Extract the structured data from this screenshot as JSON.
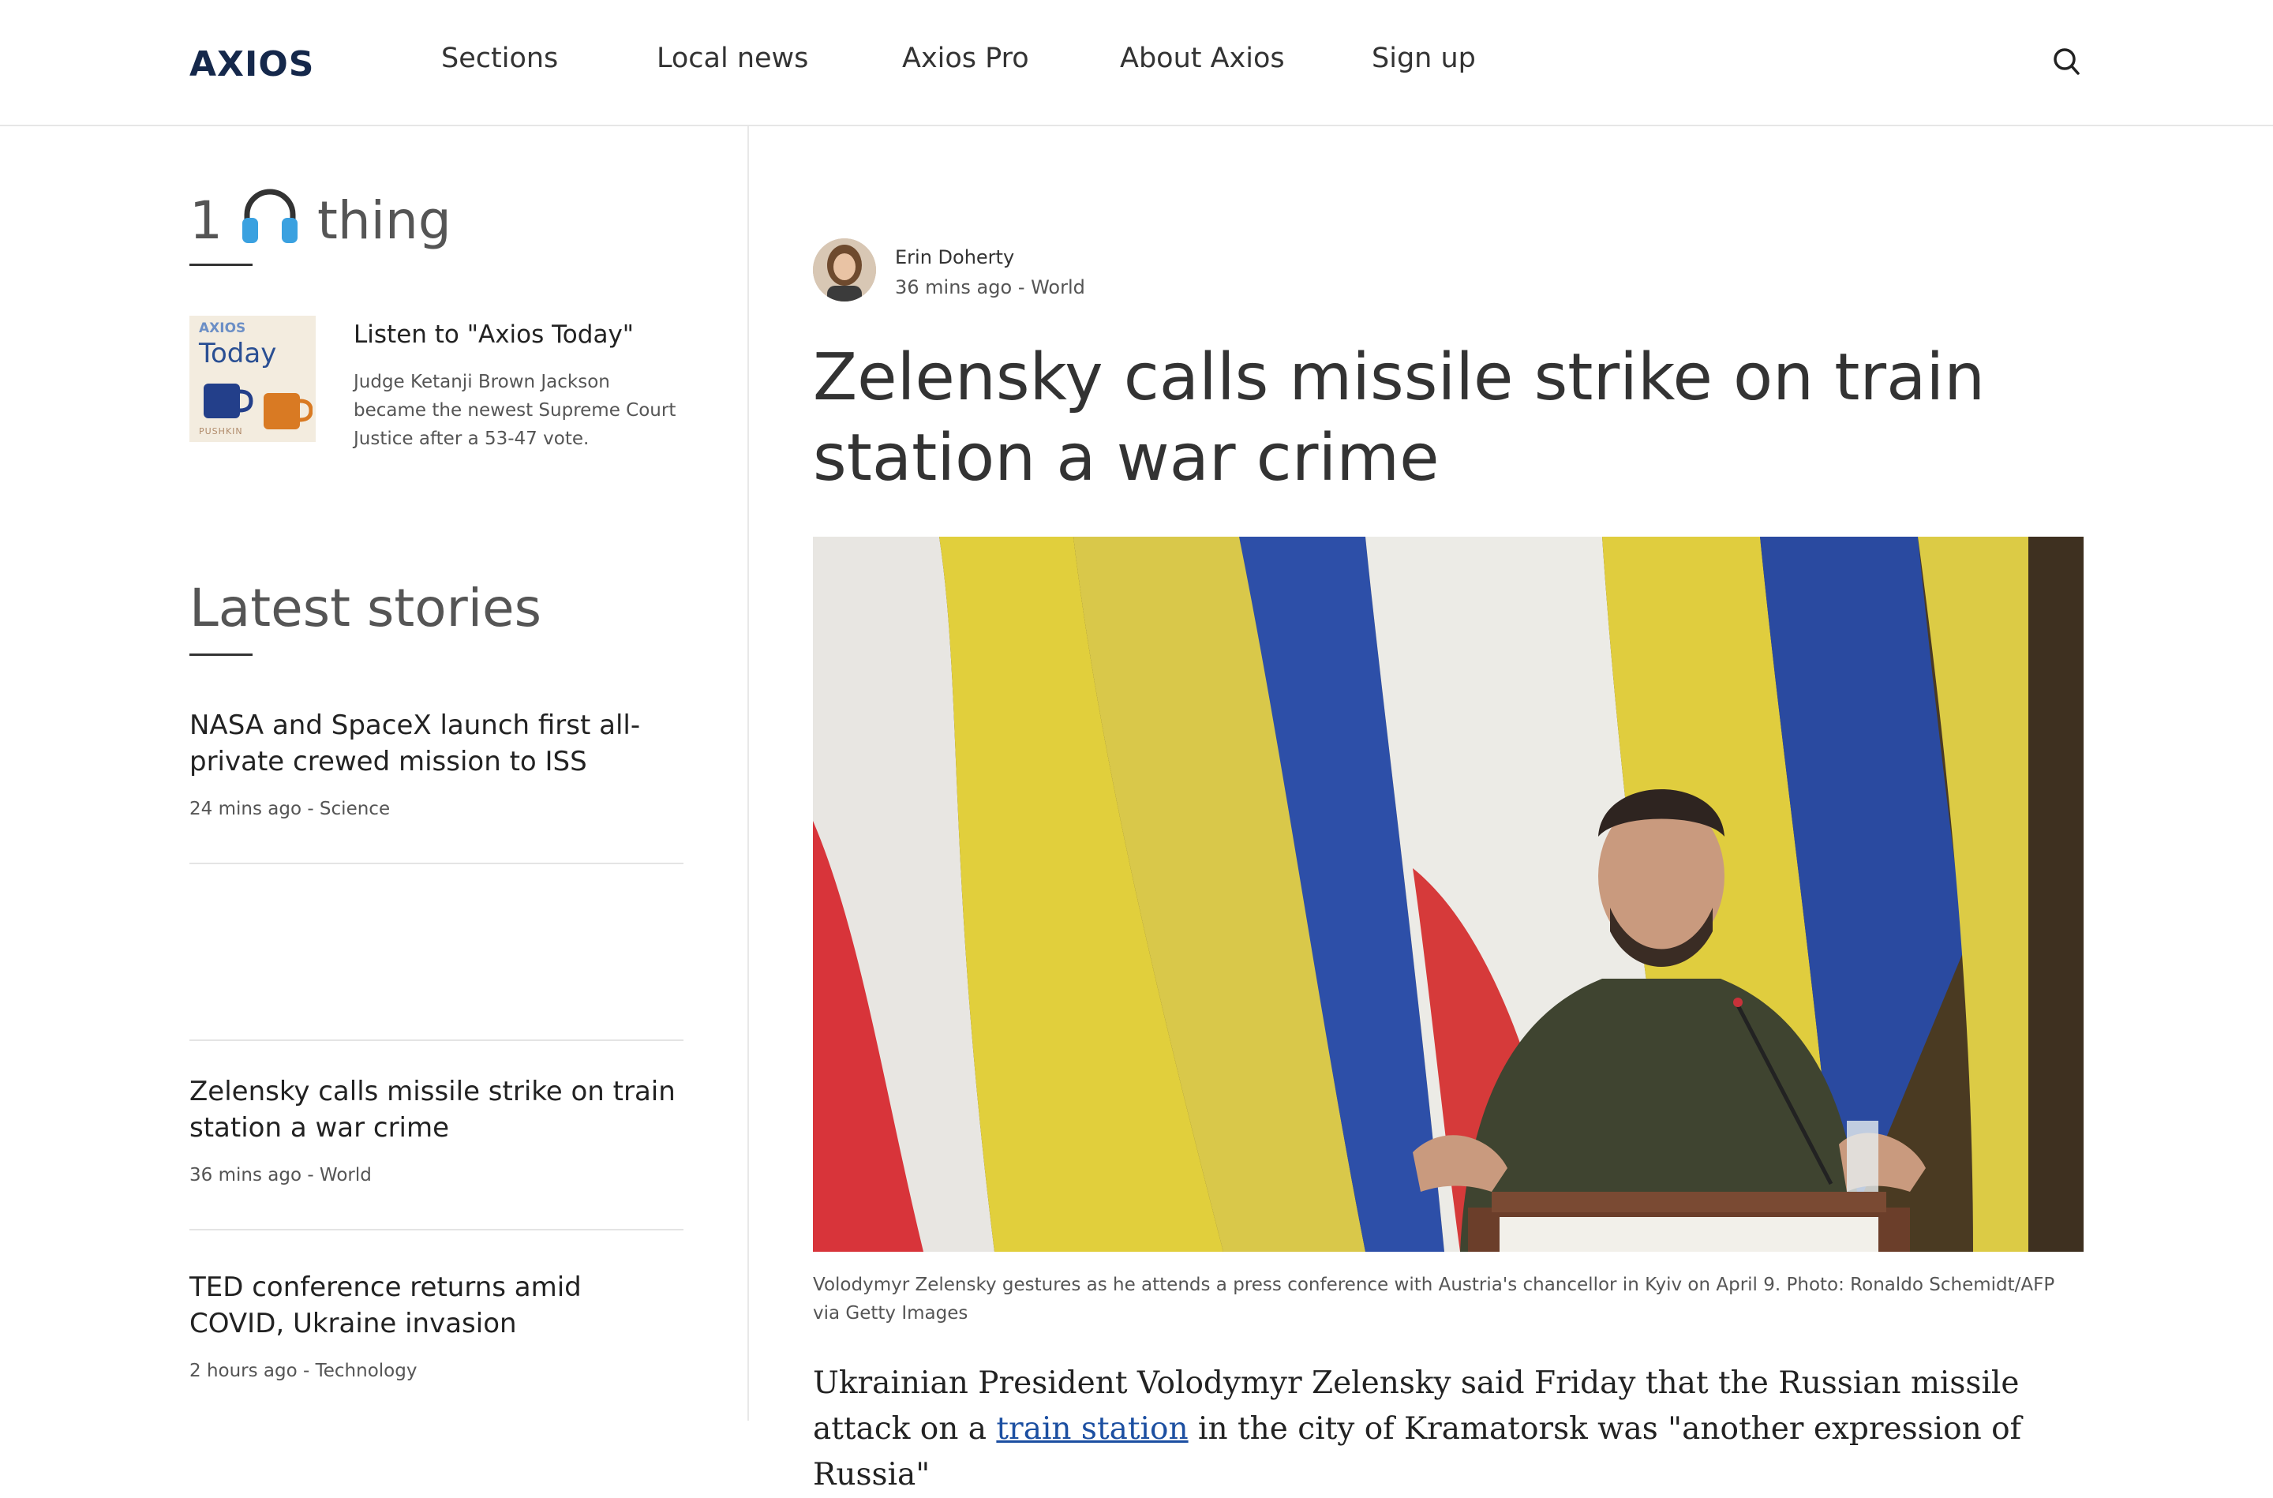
{
  "header": {
    "logo": "AXIOS",
    "nav": [
      "Sections",
      "Local news",
      "Axios Pro",
      "About Axios",
      "Sign up"
    ]
  },
  "sidebar": {
    "one_thing": {
      "number": "1",
      "word": "thing"
    },
    "podcast": {
      "thumb_brand": "AXIOS",
      "thumb_title": "Today",
      "thumb_footer": "PUSHKIN",
      "title": "Listen to \"Axios Today\"",
      "description": "Judge Ketanji Brown Jackson became the newest Supreme Court Justice after a 53-47 vote."
    },
    "latest_heading": "Latest stories",
    "stories": [
      {
        "title": "NASA and SpaceX launch first all-private crewed mission to ISS",
        "meta": "24 mins ago - Science"
      },
      {
        "title": "Zelensky calls missile strike on train station a war crime",
        "meta": "36 mins ago - World"
      },
      {
        "title": "TED conference returns amid COVID, Ukraine invasion",
        "meta": "2 hours ago - Technology"
      }
    ]
  },
  "article": {
    "author": "Erin Doherty",
    "meta": "36 mins ago - World",
    "headline": "Zelensky calls missile strike on train station a war crime",
    "caption": "Volodymyr Zelensky gestures as he attends a press conference with Austria's chancellor in Kyiv on April 9. Photo: Ronaldo Schemidt/AFP via Getty Images",
    "body_lead": "Ukrainian President Volodymyr Zelensky said Friday that the Russian missile attack on a ",
    "body_link": "train station",
    "body_rest": " in the city of Kramatorsk was \"another expression of Russia\""
  },
  "colors": {
    "brand": "#15284b",
    "link": "#1c4fa1"
  }
}
